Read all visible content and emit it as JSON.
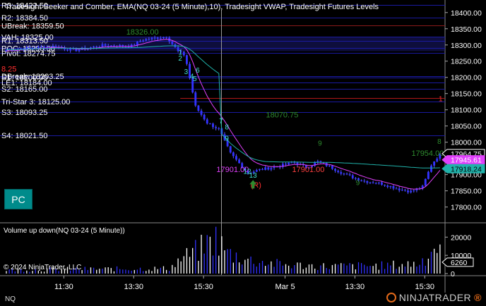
{
  "chart": {
    "title": "Tradesight Seeker and Comber, EMA(NQ 03-24 (5 Minute),10), Tradesight VWAP, Tradesight Futures Levels",
    "copyright": "© 2024 NinjaTrader, LLC",
    "pc_button": "PC",
    "instrument": "NQ",
    "brand": "NINJATRADER",
    "brand_tm": "®",
    "volume_title": "Volume up down(NQ 03-24 (5 Minute))"
  },
  "colors": {
    "bg": "#000000",
    "level_line": "#1a1aa0",
    "candle": "#3232ff",
    "ema": "#e040fb",
    "vwap": "#20b2aa",
    "red_line": "#b01818",
    "green_text": "#2e8b2e",
    "cyan_text": "#40e0d0",
    "pc_button": "#008b8b",
    "volume_up": "#ffffff",
    "volume_down": "#3232ff"
  },
  "price_axis": {
    "min": 17760,
    "max": 18430,
    "ticks": [
      "18400.00",
      "18350.00",
      "18300.00",
      "18250.00",
      "18200.00",
      "18150.00",
      "18100.00",
      "18050.00",
      "18000.00",
      "17950.00",
      "17900.00",
      "17850.00",
      "17800.00"
    ],
    "tick_values": [
      18400,
      18350,
      18300,
      18250,
      18200,
      18150,
      18100,
      18050,
      18000,
      17950,
      17900,
      17850,
      17800
    ],
    "markers": [
      {
        "text": "17964.75",
        "value": 17964.75,
        "bg": "#000000",
        "fg": "#ffffff",
        "border": "#ffffff"
      },
      {
        "text": "17945.61",
        "value": 17945.61,
        "bg": "#e040fb",
        "fg": "#ffffff",
        "border": "#e040fb"
      },
      {
        "text": "17918.24",
        "value": 17918.24,
        "bg": "#20b2aa",
        "fg": "#000000",
        "border": "#20b2aa"
      }
    ]
  },
  "volume_axis": {
    "max": 24000,
    "ticks": [
      "20000",
      "10000",
      "0"
    ],
    "tick_values": [
      20000,
      10000,
      0
    ],
    "marker": {
      "text": "6260",
      "value": 6260
    }
  },
  "time_axis": {
    "labels": [
      "11:30",
      "13:30",
      "15:30",
      "Mar 5",
      "13:30",
      "15:30"
    ],
    "index": [
      20,
      44,
      68,
      96,
      120,
      144
    ],
    "session_break": 74
  },
  "levels": [
    {
      "text": "R3: 18422.50",
      "value": 18422.5,
      "color": "#1a1aa0"
    },
    {
      "text": "R2: 18384.50",
      "value": 18384.5,
      "color": "#1a1aa0"
    },
    {
      "text": "UBreak: 18359.50",
      "value": 18359.5,
      "color": "#8b1a1a"
    },
    {
      "text": "VAH: 18325.00",
      "value": 18325,
      "color": "#1a1aa0"
    },
    {
      "text": "R1: 18313.50",
      "value": 18313.5,
      "color": "#1a1aa0"
    },
    {
      "text": "POC: 18290.00",
      "value": 18290,
      "color": "#1a1aa0"
    },
    {
      "text": "Pivot: 18274.75",
      "value": 18274.75,
      "color": "#1a1aa0"
    },
    {
      "text": "S1: 18200.00",
      "value": 18200.0,
      "color": "#1a1aa0"
    },
    {
      "text": "DBreak: 18203.25",
      "value": 18203.25,
      "color": "#1a1aa0"
    },
    {
      "text": "LE1: 18184.00",
      "value": 18184.0,
      "color": "#1a1aa0"
    },
    {
      "text": "S2: 18165.00",
      "value": 18165.0,
      "color": "#1a1aa0"
    },
    {
      "text": "Tri-Star 3: 18125.00",
      "value": 18125.0,
      "color": "#1a1aa0"
    },
    {
      "text": "S3: 18093.25",
      "value": 18093.25,
      "color": "#1a1aa0"
    },
    {
      "text": "S4: 18021.50",
      "value": 18021.5,
      "color": "#1a1aa0"
    }
  ],
  "side_text": {
    "text": "8.25",
    "color": "#ff3030"
  },
  "red_line": {
    "value": 18137,
    "from": 60,
    "label": "1"
  },
  "value_area": {
    "from": 18281,
    "to": 18325
  },
  "annotations": [
    {
      "text": "18326.00",
      "i": 47,
      "value": 18332,
      "color": "#2e8b2e"
    },
    {
      "text": "18070.75",
      "i": 95,
      "value": 18076,
      "color": "#2e8b2e"
    },
    {
      "text": "17954.00",
      "i": 145,
      "value": 17958,
      "color": "#2e8b2e"
    },
    {
      "text": "17901.00",
      "i": 104,
      "value": 17908,
      "color": "#ff4040"
    },
    {
      "text": "17901.00",
      "i": 78,
      "value": 17908,
      "color": "#e040fb"
    },
    {
      "text": "(R)",
      "i": 86,
      "value": 17860,
      "color": "#ff3030"
    }
  ],
  "seq_numbers": [
    {
      "text": "1",
      "i": 60,
      "value": 18270,
      "color": "#40e0d0"
    },
    {
      "text": "2",
      "i": 60,
      "value": 18252,
      "color": "#40e0d0"
    },
    {
      "text": "3",
      "i": 62,
      "value": 18210,
      "color": "#40e0d0"
    },
    {
      "text": "4",
      "i": 64,
      "value": 18196,
      "color": "#40e0d0"
    },
    {
      "text": "5",
      "i": 65,
      "value": 18188,
      "color": "#40e0d0"
    },
    {
      "text": "6",
      "i": 66,
      "value": 18215,
      "color": "#40e0d0"
    },
    {
      "text": "7",
      "i": 74,
      "value": 18058,
      "color": "#40e0d0"
    },
    {
      "text": "8",
      "i": 76,
      "value": 18040,
      "color": "#40e0d0"
    },
    {
      "text": "9",
      "i": 76,
      "value": 18005,
      "color": "#40e0d0"
    },
    {
      "text": "12",
      "i": 83,
      "value": 17902,
      "color": "#40e0d0"
    },
    {
      "text": "13",
      "i": 85,
      "value": 17890,
      "color": "#40e0d0"
    },
    {
      "text": "9",
      "i": 121,
      "value": 17868,
      "color": "#2e8b2e"
    },
    {
      "text": "8",
      "i": 149,
      "value": 17995,
      "color": "#2e8b2e"
    },
    {
      "text": "9",
      "i": 108,
      "value": 17990,
      "color": "#2e8b2e"
    }
  ],
  "green_arrow": {
    "i": 85,
    "value": 17870
  },
  "bars": {
    "count": 150,
    "open": 18280,
    "close": 17964.75,
    "points": [
      [
        0,
        18285
      ],
      [
        18,
        18296
      ],
      [
        24,
        18283
      ],
      [
        34,
        18298
      ],
      [
        44,
        18297
      ],
      [
        48,
        18316
      ],
      [
        56,
        18326
      ],
      [
        60,
        18280
      ],
      [
        62,
        18270
      ],
      [
        63,
        18242
      ],
      [
        66,
        18110
      ],
      [
        70,
        18060
      ],
      [
        74,
        18040
      ],
      [
        78,
        17965
      ],
      [
        84,
        17905
      ],
      [
        88,
        17915
      ],
      [
        94,
        17925
      ],
      [
        100,
        17938
      ],
      [
        104,
        17922
      ],
      [
        108,
        17940
      ],
      [
        112,
        17925
      ],
      [
        118,
        17898
      ],
      [
        124,
        17880
      ],
      [
        130,
        17872
      ],
      [
        136,
        17855
      ],
      [
        140,
        17848
      ],
      [
        144,
        17862
      ],
      [
        147,
        17930
      ],
      [
        150,
        17964.75
      ]
    ],
    "volume_shape": [
      [
        0,
        2500
      ],
      [
        20,
        3000
      ],
      [
        40,
        3200
      ],
      [
        56,
        3500
      ],
      [
        60,
        10000
      ],
      [
        66,
        16000
      ],
      [
        72,
        24000
      ],
      [
        76,
        14000
      ],
      [
        84,
        9000
      ],
      [
        95,
        6000
      ],
      [
        110,
        5000
      ],
      [
        130,
        5500
      ],
      [
        142,
        7000
      ],
      [
        146,
        16000
      ],
      [
        150,
        22000
      ]
    ]
  }
}
